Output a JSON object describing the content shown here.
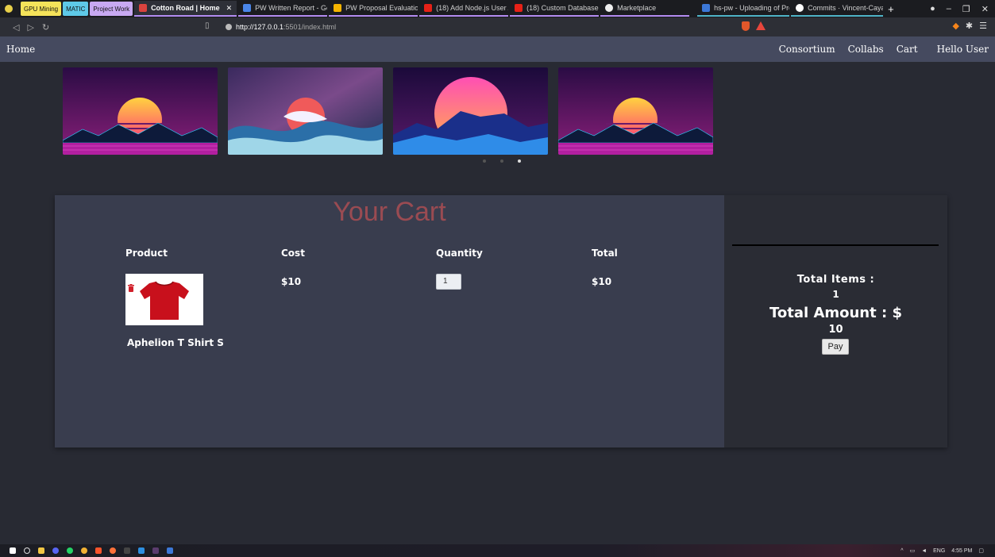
{
  "browser": {
    "tab_groups": [
      {
        "label": "GPU Mining",
        "color": "#f5e35a"
      },
      {
        "label": "MATIC",
        "color": "#5ec9e8"
      },
      {
        "label": "Project Work",
        "color": "#c8a9f2"
      }
    ],
    "tabs": [
      {
        "label": "Cotton Road | Home",
        "active": true
      },
      {
        "label": "PW Written Report - Goog"
      },
      {
        "label": "PW Proposal Evaluation - ("
      },
      {
        "label": "(18) Add Node.js User Aut"
      },
      {
        "label": "(18) Custom Databases: Cr"
      },
      {
        "label": "Marketplace"
      },
      {
        "label": "hs-pw - Uploading of Proj"
      },
      {
        "label": "Commits · Vincent-Cayadu"
      }
    ],
    "new_tab": "+",
    "url_host": "http://127.0.0.1",
    "url_rest": ":5501/index.html"
  },
  "navbar": {
    "home": "Home",
    "links": [
      "Consortium",
      "Collabs",
      "Cart"
    ],
    "greeting": "Hello User"
  },
  "cart": {
    "title": "Your Cart",
    "headers": {
      "product": "Product",
      "cost": "Cost",
      "quantity": "Quantity",
      "total": "Total"
    },
    "item": {
      "name": "Aphelion T Shirt S",
      "cost": "$10",
      "quantity": "1",
      "total": "$10"
    },
    "summary": {
      "total_items_label": "Total Items :",
      "total_items_value": "1",
      "total_amount_label": "Total Amount : $",
      "total_amount_value": "10",
      "pay_label": "Pay"
    }
  },
  "taskbar": {
    "lang": "ENG",
    "time": "4:55 PM"
  }
}
